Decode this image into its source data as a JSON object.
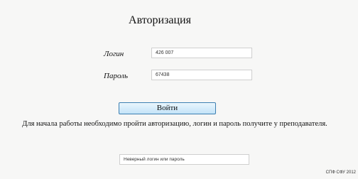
{
  "title": "Авторизация",
  "login": {
    "label": "Логин",
    "value": "426 007"
  },
  "password": {
    "label": "Пароль",
    "value": "67438"
  },
  "button": {
    "label": "Войти"
  },
  "info_text": "Для начала работы необходимо пройти авторизацию, логин и пароль получите у преподавателя.",
  "error_text": "Неверный логин или пароль",
  "copyright": "СПФ СФУ 2012"
}
